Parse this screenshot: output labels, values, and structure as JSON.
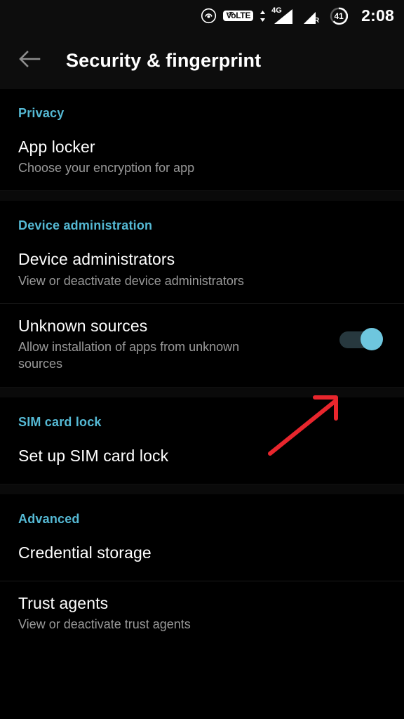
{
  "statusbar": {
    "icons": [
      "cast-icon",
      "volte-icon",
      "data-transfer-icon",
      "signal-4g-icon",
      "signal-roaming-icon",
      "battery-icon"
    ],
    "volte_label": "LTE",
    "volte_prefix": "Vo",
    "network_label": "4G",
    "roaming_label": "R",
    "battery_level": "41",
    "time": "2:08"
  },
  "appbar": {
    "back_icon": "arrow-left-icon",
    "title": "Security & fingerprint"
  },
  "colors": {
    "accent": "#55b9d4",
    "background": "#000000",
    "surface": "#0d0d0d",
    "toggle_thumb_on": "#6ec6de",
    "toggle_track_on": "#27383e",
    "annotation": "#e8262d",
    "subtitle": "#9a9a9a"
  },
  "sections": [
    {
      "header": "Privacy",
      "rows": [
        {
          "title": "App locker",
          "subtitle": "Choose your encryption for app",
          "control": "none"
        }
      ]
    },
    {
      "header": "Device administration",
      "rows": [
        {
          "title": "Device administrators",
          "subtitle": "View or deactivate device administrators",
          "control": "none"
        },
        {
          "title": "Unknown sources",
          "subtitle": "Allow installation of apps from unknown sources",
          "control": "toggle",
          "toggle_state": "on"
        }
      ]
    },
    {
      "header": "SIM card lock",
      "rows": [
        {
          "title": "Set up SIM card lock",
          "subtitle": "",
          "control": "none"
        }
      ]
    },
    {
      "header": "Advanced",
      "rows": [
        {
          "title": "Credential storage",
          "subtitle": "",
          "control": "none"
        },
        {
          "title": "Trust agents",
          "subtitle": "View or deactivate trust agents",
          "control": "none"
        }
      ]
    }
  ],
  "annotation": {
    "type": "arrow",
    "points_to": "unknown-sources-toggle",
    "color": "#e8262d"
  }
}
